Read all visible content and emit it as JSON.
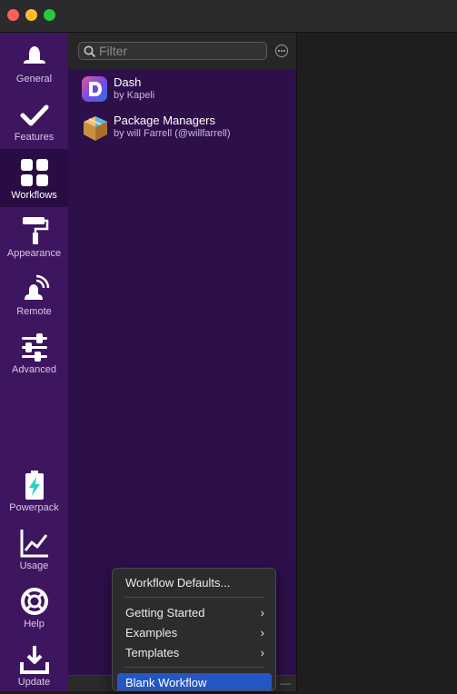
{
  "sidebar": {
    "items": [
      {
        "label": "General",
        "icon": "bowler-hat-icon"
      },
      {
        "label": "Features",
        "icon": "checkmark-icon"
      },
      {
        "label": "Workflows",
        "icon": "grid-icon",
        "active": true
      },
      {
        "label": "Appearance",
        "icon": "paint-roller-icon"
      },
      {
        "label": "Remote",
        "icon": "remote-icon"
      },
      {
        "label": "Advanced",
        "icon": "sliders-icon"
      }
    ],
    "bottom_items": [
      {
        "label": "Powerpack",
        "icon": "battery-bolt-icon"
      },
      {
        "label": "Usage",
        "icon": "chart-icon"
      },
      {
        "label": "Help",
        "icon": "lifebuoy-icon"
      },
      {
        "label": "Update",
        "icon": "download-icon"
      }
    ]
  },
  "filter": {
    "placeholder": "Filter",
    "value": ""
  },
  "workflows": [
    {
      "name": "Dash",
      "author": "by Kapeli",
      "icon": "dash-app-icon"
    },
    {
      "name": "Package Managers",
      "author": "by will Farrell (@willfarrell)",
      "icon": "package-box-icon"
    }
  ],
  "context_menu": {
    "items": [
      {
        "label": "Workflow Defaults...",
        "submenu": false
      },
      {
        "label": "Getting Started",
        "submenu": true
      },
      {
        "label": "Examples",
        "submenu": true
      },
      {
        "label": "Templates",
        "submenu": true
      },
      {
        "label": "Blank Workflow",
        "submenu": false,
        "selected": true
      }
    ],
    "chevron": "›"
  },
  "bottombar": {
    "minus": "—"
  },
  "colors": {
    "sidebar": "#3e1660",
    "sidebar_active": "#2a0c45",
    "list_bg": "#2d0f4a",
    "selection": "#2457c5",
    "powerpack_accent": "#2bd1c0"
  }
}
